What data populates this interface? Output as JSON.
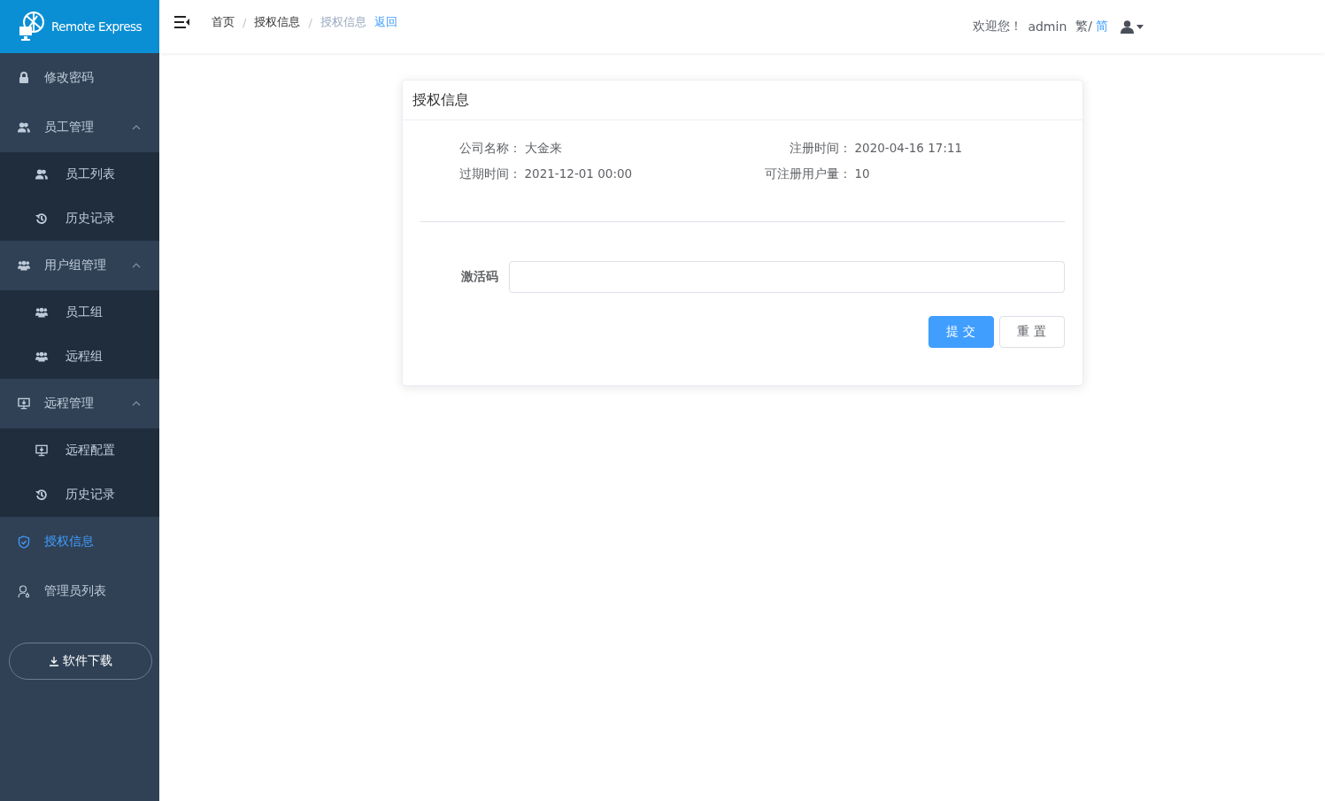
{
  "logo": {
    "text": "Remote Express"
  },
  "sidebar": {
    "items": [
      {
        "kind": "item",
        "label": "修改密码",
        "selected": false
      },
      {
        "kind": "group",
        "label": "员工管理",
        "expanded": true,
        "children": [
          {
            "label": "员工列表",
            "selected": false
          },
          {
            "label": "历史记录",
            "selected": false
          }
        ]
      },
      {
        "kind": "group",
        "label": "用户组管理",
        "expanded": true,
        "children": [
          {
            "label": "员工组",
            "selected": false
          },
          {
            "label": "远程组",
            "selected": false
          }
        ]
      },
      {
        "kind": "group",
        "label": "远程管理",
        "expanded": true,
        "children": [
          {
            "label": "远程配置",
            "selected": false
          },
          {
            "label": "历史记录",
            "selected": false
          }
        ]
      },
      {
        "kind": "item",
        "label": "授权信息",
        "selected": true
      },
      {
        "kind": "item",
        "label": "管理员列表",
        "selected": false
      }
    ],
    "download_button": "软件下载"
  },
  "header": {
    "breadcrumb": [
      "首页",
      "授权信息",
      "授权信息"
    ],
    "separator": "/",
    "back_link": "返回",
    "welcome": "欢迎您！",
    "username": "admin",
    "languages": [
      {
        "label": "繁/",
        "selected": false
      },
      {
        "label": "简",
        "selected": true
      }
    ]
  },
  "card": {
    "title": "授权信息",
    "info": [
      {
        "label": "公司名称：",
        "value": "大金来"
      },
      {
        "label": "注册时间：",
        "value": "2020-04-16 17:11"
      },
      {
        "label": "过期时间：",
        "value": "2021-12-01 00:00"
      },
      {
        "label": "可注册用户量：",
        "value": "10"
      }
    ],
    "activation": {
      "label": "激活码"
    },
    "buttons": [
      {
        "label": "提 交",
        "kind": "primary"
      },
      {
        "label": "重 置",
        "kind": "default"
      }
    ]
  }
}
